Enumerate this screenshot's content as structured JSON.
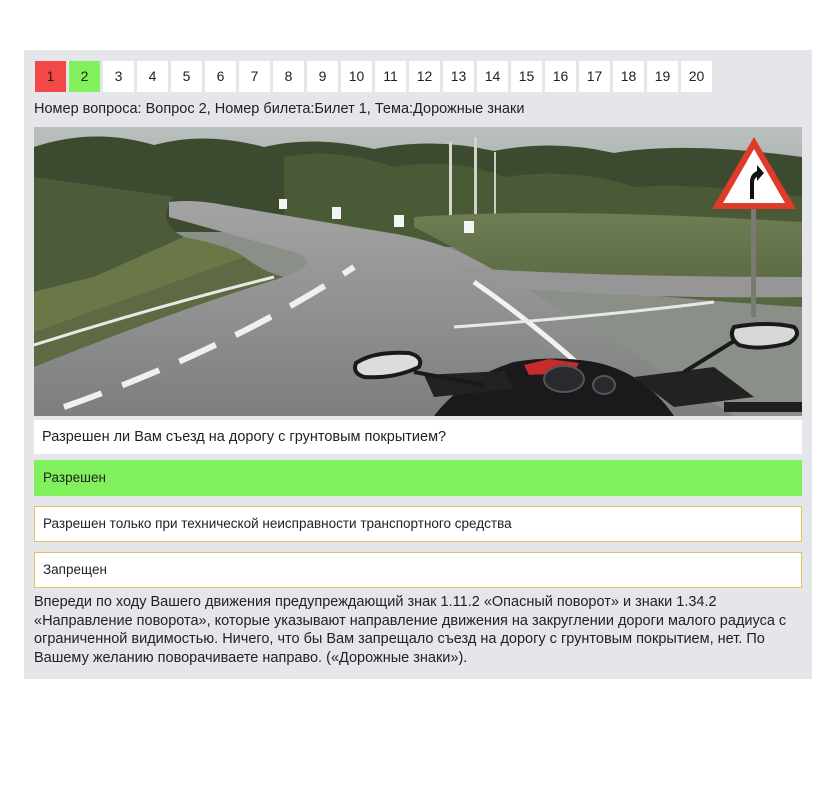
{
  "question_nav": {
    "items": [
      "1",
      "2",
      "3",
      "4",
      "5",
      "6",
      "7",
      "8",
      "9",
      "10",
      "11",
      "12",
      "13",
      "14",
      "15",
      "16",
      "17",
      "18",
      "19",
      "20"
    ],
    "statuses": [
      "wrong",
      "right",
      "",
      "",
      "",
      "",
      "",
      "",
      "",
      "",
      "",
      "",
      "",
      "",
      "",
      "",
      "",
      "",
      "",
      ""
    ],
    "colors": {
      "wrong": "#f44848",
      "right": "#80f05c"
    }
  },
  "meta_line": "Номер вопроса: Вопрос 2, Номер билета:Билет 1, Тема:Дорожные знаки",
  "question": "Разрешен ли Вам съезд на дорогу с грунтовым покрытием?",
  "answers": [
    {
      "text": "Разрешен",
      "state": "correct"
    },
    {
      "text": "Разрешен только при технической неисправности транспортного средства",
      "state": ""
    },
    {
      "text": "Запрещен",
      "state": ""
    }
  ],
  "explanation": "Впереди по ходу Вашего движения предупреждающий знак 1.11.2 «Опасный поворот» и знаки 1.34.2 «Направление поворота», которые указывают направление движения на закруглении дороги малого радиуса с ограниченной видимостью. Ничего, что бы Вам запрещало съезд на дорогу с грунтовым покрытием, нет. По Вашему желанию поворачиваете направо. («Дорожные знаки»).",
  "colors": {
    "panel": "#e4e6ea",
    "answer_border": "#e6c25a",
    "correct": "#80f05c"
  },
  "image": {
    "icon": "warning-sign-dangerous-curve-icon"
  }
}
